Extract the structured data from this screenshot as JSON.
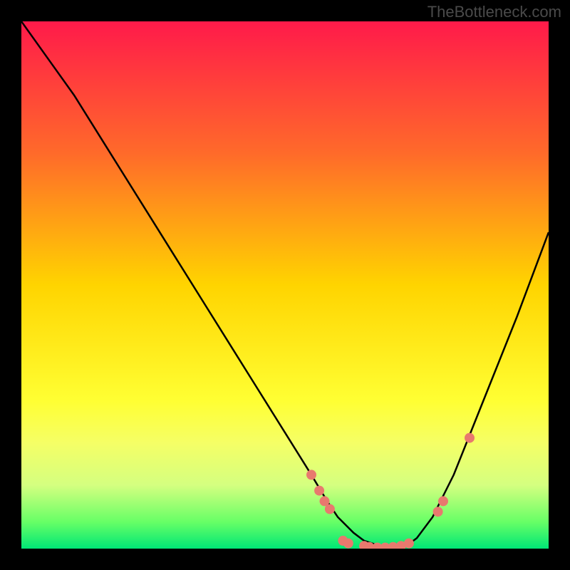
{
  "watermark": "TheBottleneck.com",
  "chart_data": {
    "type": "line",
    "title": "",
    "xlabel": "",
    "ylabel": "",
    "xlim": [
      0,
      100
    ],
    "ylim": [
      0,
      100
    ],
    "gradient_stops": [
      {
        "offset": 0,
        "color": "#ff1a4a"
      },
      {
        "offset": 25,
        "color": "#ff6a2a"
      },
      {
        "offset": 50,
        "color": "#ffd400"
      },
      {
        "offset": 72,
        "color": "#ffff33"
      },
      {
        "offset": 80,
        "color": "#f5ff66"
      },
      {
        "offset": 88,
        "color": "#d4ff80"
      },
      {
        "offset": 95,
        "color": "#66ff66"
      },
      {
        "offset": 100,
        "color": "#00e676"
      }
    ],
    "series": [
      {
        "name": "curve",
        "type": "line",
        "x": [
          0,
          5,
          10,
          15,
          20,
          25,
          30,
          35,
          40,
          45,
          50,
          55,
          58,
          60,
          63,
          65,
          68,
          70,
          73,
          75,
          78,
          82,
          86,
          90,
          94,
          100
        ],
        "y": [
          100,
          93,
          86,
          78,
          70,
          62,
          54,
          46,
          38,
          30,
          22,
          14,
          9,
          6,
          3,
          1.5,
          0.5,
          0,
          0.5,
          2,
          6,
          14,
          24,
          34,
          44,
          60
        ]
      },
      {
        "name": "markers",
        "type": "scatter",
        "points": [
          {
            "x": 55,
            "y": 14
          },
          {
            "x": 56.5,
            "y": 11
          },
          {
            "x": 57.5,
            "y": 9
          },
          {
            "x": 58.5,
            "y": 7.5
          },
          {
            "x": 61,
            "y": 1.5
          },
          {
            "x": 62,
            "y": 1
          },
          {
            "x": 65,
            "y": 0.5
          },
          {
            "x": 66,
            "y": 0.3
          },
          {
            "x": 67.5,
            "y": 0.2
          },
          {
            "x": 69,
            "y": 0.2
          },
          {
            "x": 70.5,
            "y": 0.3
          },
          {
            "x": 72,
            "y": 0.5
          },
          {
            "x": 73.5,
            "y": 1
          },
          {
            "x": 79,
            "y": 7
          },
          {
            "x": 80,
            "y": 9
          },
          {
            "x": 85,
            "y": 21
          }
        ],
        "color": "#e8796e"
      }
    ]
  }
}
